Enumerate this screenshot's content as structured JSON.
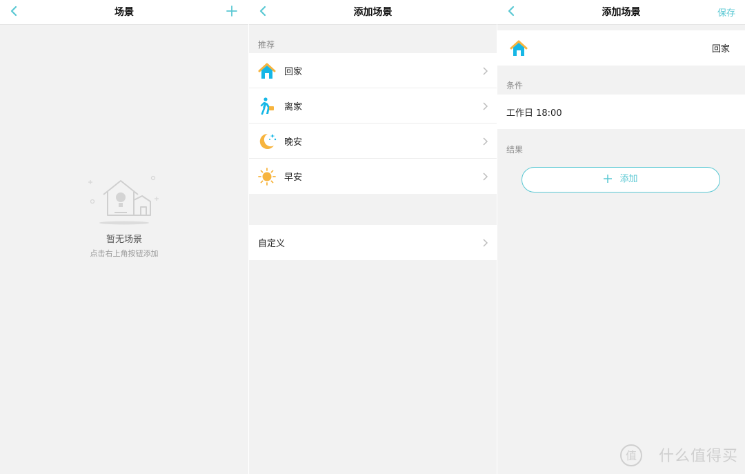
{
  "panel1": {
    "title": "场景",
    "empty_title": "暂无场景",
    "empty_hint": "点击右上角按钮添加"
  },
  "panel2": {
    "title": "添加场景",
    "section_recommend": "推荐",
    "recommended": [
      {
        "label": "回家",
        "icon": "home-icon"
      },
      {
        "label": "离家",
        "icon": "walking-person-icon"
      },
      {
        "label": "晚安",
        "icon": "moon-icon"
      },
      {
        "label": "早安",
        "icon": "sun-icon"
      }
    ],
    "custom_label": "自定义"
  },
  "panel3": {
    "title": "添加场景",
    "save_label": "保存",
    "scene_name": "回家",
    "section_conditions": "条件",
    "condition_value": "工作日 18:00",
    "section_results": "结果",
    "add_label": "添加"
  },
  "watermark": "什么值得买",
  "colors": {
    "accent": "#5ac8d3",
    "icon_orange": "#f7b43e",
    "icon_blue": "#16b7e6"
  }
}
